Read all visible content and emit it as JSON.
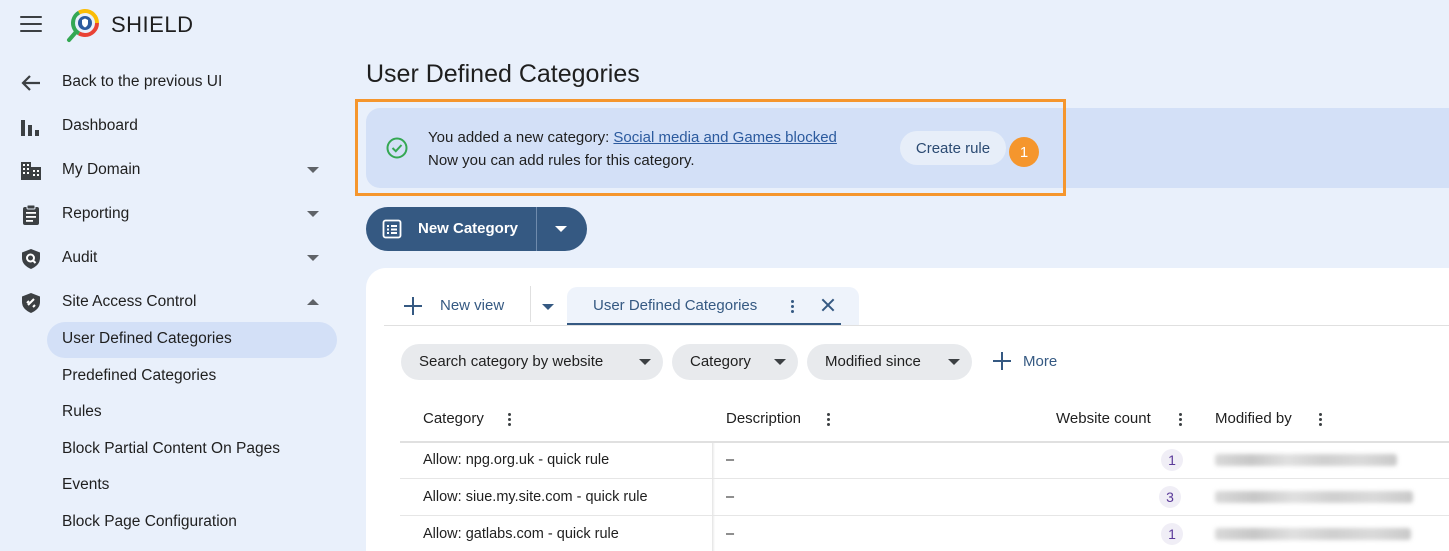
{
  "app": {
    "brand": "SHIELD"
  },
  "sidebar": {
    "back_label": "Back to the previous UI",
    "items": [
      {
        "label": "Dashboard",
        "icon": "bar-chart-icon"
      },
      {
        "label": "My Domain",
        "icon": "building-icon"
      },
      {
        "label": "Reporting",
        "icon": "clipboard-icon"
      },
      {
        "label": "Audit",
        "icon": "shield-search-icon"
      },
      {
        "label": "Site Access Control",
        "icon": "shield-link-icon"
      }
    ],
    "subitems": [
      {
        "label": "User Defined Categories",
        "active": true
      },
      {
        "label": "Predefined Categories"
      },
      {
        "label": "Rules"
      },
      {
        "label": "Block Partial Content On Pages"
      },
      {
        "label": "Events"
      },
      {
        "label": "Block Page Configuration"
      }
    ]
  },
  "main": {
    "title": "User Defined Categories",
    "banner": {
      "prefix": "You added a new category: ",
      "link": "Social media and Games blocked",
      "line2": "Now you can add rules for this category.",
      "action": "Create rule",
      "badge": "1"
    },
    "new_category_label": "New Category",
    "tabs": {
      "new_view": "New view",
      "active_tab": "User Defined Categories"
    },
    "filters": [
      "Search category by website",
      "Category",
      "Modified since"
    ],
    "more_label": "More",
    "table": {
      "headers": [
        "Category",
        "Description",
        "Website count",
        "Modified by"
      ],
      "rows": [
        {
          "category": "Allow: npg.org.uk - quick rule",
          "description": "–",
          "count": "1"
        },
        {
          "category": "Allow: siue.my.site.com - quick rule",
          "description": "–",
          "count": "3"
        },
        {
          "category": "Allow: gatlabs.com - quick rule",
          "description": "–",
          "count": "1"
        }
      ]
    }
  },
  "colors": {
    "accent": "#355982",
    "highlight": "#f5962d",
    "banner": "#d3e0f7",
    "background": "#e9f0fb"
  }
}
